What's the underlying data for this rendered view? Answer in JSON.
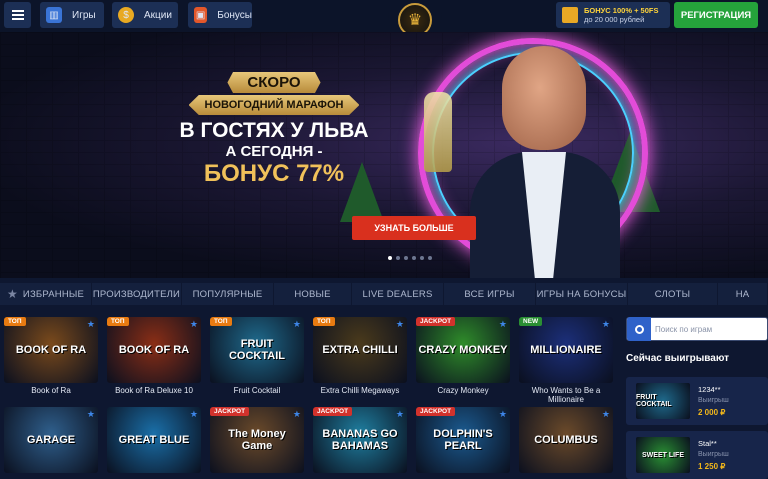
{
  "header": {
    "nav": [
      {
        "label": "Игры",
        "icon": "slot-machine-icon"
      },
      {
        "label": "Акции",
        "icon": "coin-icon"
      },
      {
        "label": "Бонусы",
        "icon": "gift-icon"
      }
    ],
    "bonus_line1": "БОНУС 100% + 50FS",
    "bonus_line2": "до 20 000 рублей",
    "register_label": "РЕГИСТРАЦИЯ"
  },
  "hero": {
    "line1": "СКОРО",
    "line2": "НОВОГОДНИЙ МАРАФОН",
    "line3": "В ГОСТЯХ У ЛЬВА",
    "line4": "А СЕГОДНЯ -",
    "line5": "БОНУС 77%",
    "button_label": "УЗНАТЬ БОЛЬШЕ",
    "slides_count": 6,
    "active_slide": 1
  },
  "tabs": [
    {
      "label": "ИЗБРАННЫЕ"
    },
    {
      "label": "ПРОИЗВОДИТЕЛИ"
    },
    {
      "label": "ПОПУЛЯРНЫЕ"
    },
    {
      "label": "НОВЫЕ"
    },
    {
      "label": "LIVE DEALERS"
    },
    {
      "label": "ВСЕ ИГРЫ"
    },
    {
      "label": "ИГРЫ НА БОНУСЫ"
    },
    {
      "label": "СЛОТЫ"
    },
    {
      "label": "НА"
    }
  ],
  "games": [
    {
      "name": "Book of Ra",
      "art": "BOOK OF RA",
      "badge": "ТОП",
      "color": "#7a4a1c"
    },
    {
      "name": "Book of Ra Deluxe 10",
      "art": "BOOK OF RA",
      "badge": "ТОП",
      "color": "#8a2e16"
    },
    {
      "name": "Fruit Cocktail",
      "art": "FRUIT COCKTAIL",
      "badge": "ТОП",
      "color": "#1f6a8c"
    },
    {
      "name": "Extra Chilli Megaways",
      "art": "EXTRA CHILLI",
      "badge": "ТОП",
      "color": "#4a3a1c"
    },
    {
      "name": "Crazy Monkey",
      "art": "CRAZY MONKEY",
      "badge": "JACKPOT",
      "color": "#2f8c2a"
    },
    {
      "name": "Who Wants to Be a Millionaire",
      "art": "MILLIONAIRE",
      "badge": "NEW",
      "color": "#1c2f7a"
    },
    {
      "name": "",
      "art": "GARAGE",
      "badge": "",
      "color": "#2f5f8c"
    },
    {
      "name": "",
      "art": "GREAT BLUE",
      "badge": "",
      "color": "#1a6fa8"
    },
    {
      "name": "",
      "art": "The Money Game",
      "badge": "JACKPOT",
      "color": "#6b4a2a"
    },
    {
      "name": "",
      "art": "BANANAS GO BAHAMAS",
      "badge": "JACKPOT",
      "color": "#1f7fa0"
    },
    {
      "name": "",
      "art": "DOLPHIN'S PEARL",
      "badge": "JACKPOT",
      "color": "#1b5a8f"
    },
    {
      "name": "",
      "art": "COLUMBUS",
      "badge": "",
      "color": "#6b4a2a"
    }
  ],
  "sidebar": {
    "search_placeholder": "Поиск по играм",
    "winners_title": "Сейчас выигрывают",
    "winners": [
      {
        "user": "1234**",
        "label": "Выигрыш",
        "amount": "2 000 ₽",
        "game": "FRUIT COCKTAIL",
        "color": "#1f6a8c"
      },
      {
        "user": "Stal**",
        "label": "Выигрыш",
        "amount": "1 250 ₽",
        "game": "SWEET LIFE",
        "color": "#2a8f33"
      }
    ]
  }
}
